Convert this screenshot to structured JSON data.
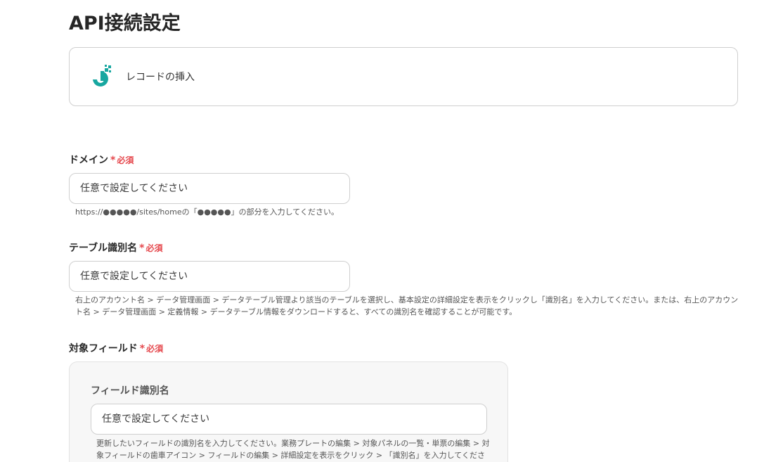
{
  "page": {
    "title": "API接続設定"
  },
  "action": {
    "name": "レコードの挿入",
    "logo_icon": "app-logo-icon",
    "logo_color": "#17a7a0"
  },
  "required_label": "必須",
  "required_mark": "*",
  "fields": {
    "domain": {
      "label": "ドメイン",
      "placeholder": "任意で設定してください",
      "help": "https://●●●●●/sites/homeの「●●●●●」の部分を入力してください。"
    },
    "table_id": {
      "label": "テーブル識別名",
      "placeholder": "任意で設定してください",
      "help": "右上のアカウント名 > データ管理画面 > データテーブル管理より該当のテーブルを選択し、基本設定の詳細設定を表示をクリックし「識別名」を入力してください。または、右上のアカウント名 > データ管理画面 > 定義情報 > データテーブル情報をダウンロードすると、すべての識別名を確認することが可能です。"
    },
    "target_field": {
      "label": "対象フィールド",
      "sub_field": {
        "label": "フィールド識別名",
        "placeholder": "任意で設定してください",
        "help": "更新したいフィールドの識別名を入力してください。業務プレートの編集 > 対象パネルの一覧・単票の編集 > 対象フィールドの歯車アイコン > フィールドの編集 > 詳細設定を表示をクリック > 「識別名」を入力してください。"
      }
    }
  },
  "colors": {
    "required": "#e5484d",
    "border": "#cfcfcf",
    "panel_bg": "#f7f7f7"
  }
}
